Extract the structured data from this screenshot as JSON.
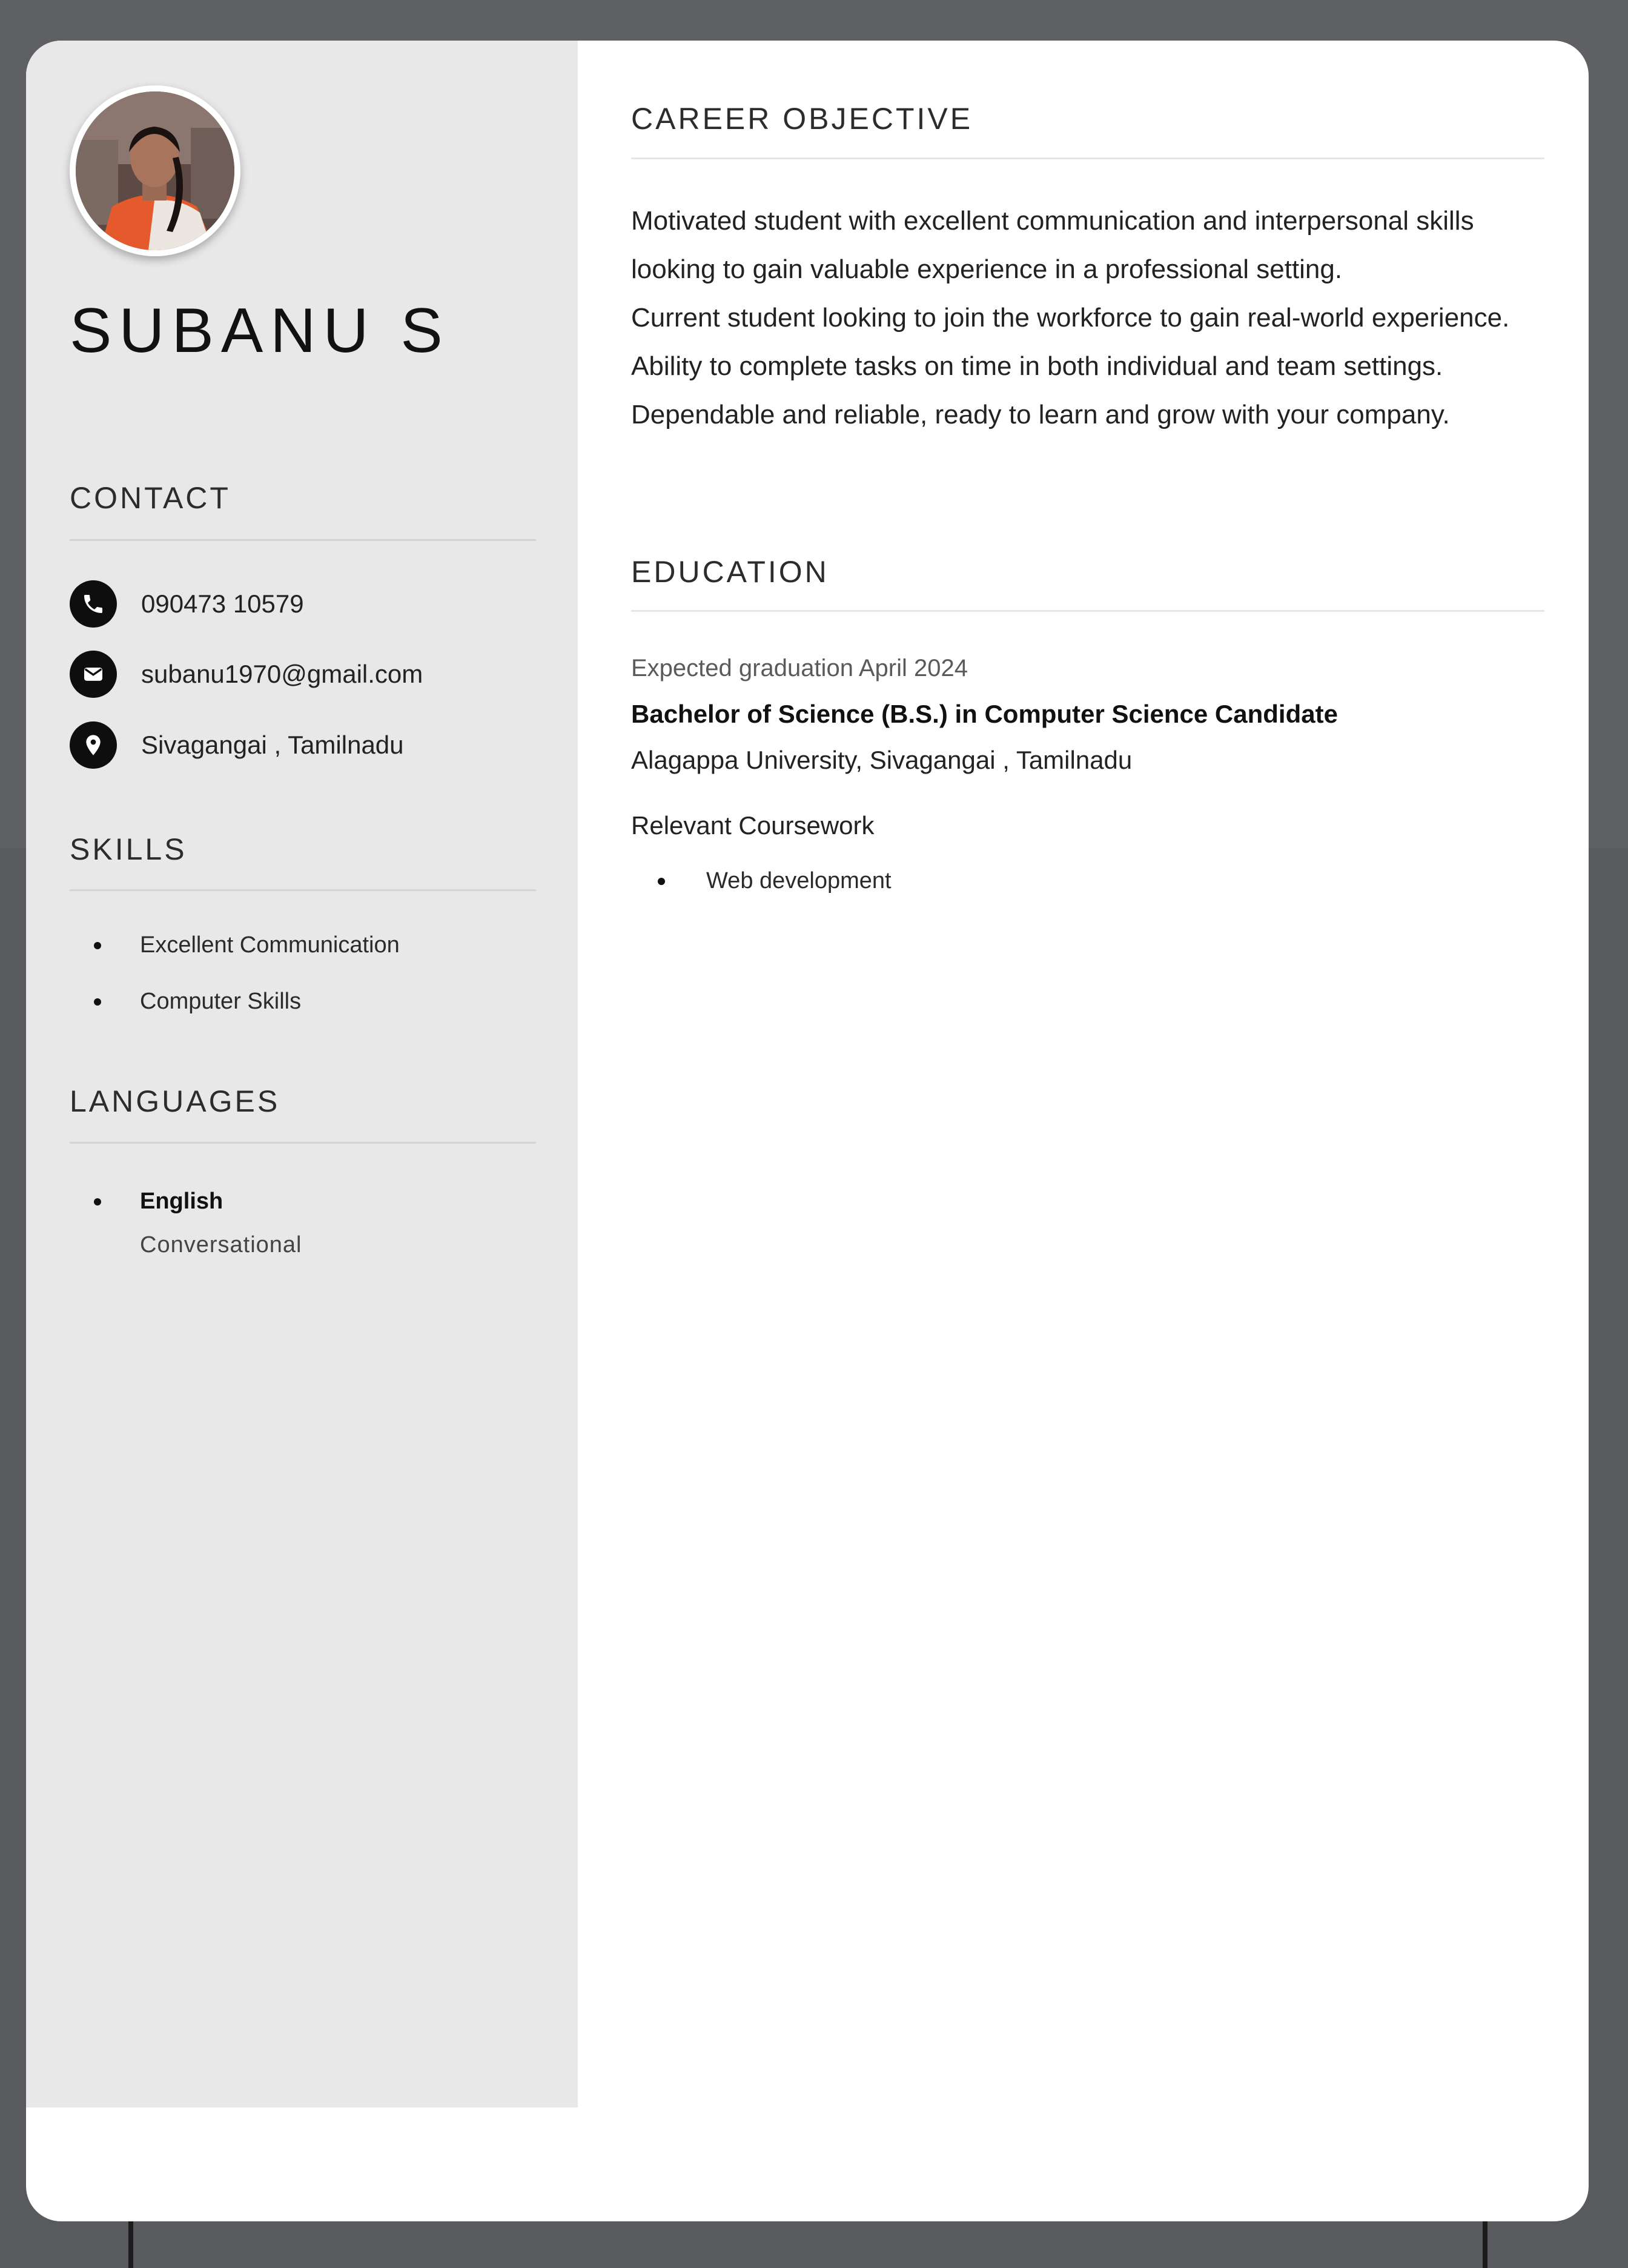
{
  "profile": {
    "name": "SUBANU S"
  },
  "contact": {
    "heading": "CONTACT",
    "phone": "090473 10579",
    "email": "subanu1970@gmail.com",
    "location": "Sivagangai , Tamilnadu"
  },
  "skills": {
    "heading": "SKILLS",
    "items": [
      "Excellent Communication",
      "Computer Skills"
    ]
  },
  "languages": {
    "heading": "LANGUAGES",
    "items": [
      {
        "name": "English",
        "level": "Conversational"
      }
    ]
  },
  "objective": {
    "heading": "CAREER OBJECTIVE",
    "paragraphs": [
      "Motivated student with excellent communication and interpersonal skills looking to gain valuable experience in a professional setting.",
      "Current student looking to join the workforce to gain real-world experience. Ability to complete tasks on time in both individual and team settings. Dependable and reliable, ready to learn and grow with your company."
    ]
  },
  "education": {
    "heading": "EDUCATION",
    "date": "Expected graduation April 2024",
    "degree": "Bachelor of Science (B.S.) in Computer Science Candidate",
    "school": "Alagappa University, Sivagangai , Tamilnadu",
    "coursework_title": "Relevant Coursework",
    "coursework": [
      "Web development"
    ]
  },
  "colors": {
    "page_background": "#5f6063",
    "sidebar": "#e8e8e8",
    "text": "#222222",
    "icon_fill": "#0e0e0e"
  },
  "icons": {
    "phone": "phone-icon",
    "email": "mail-icon",
    "location": "map-pin-icon"
  }
}
